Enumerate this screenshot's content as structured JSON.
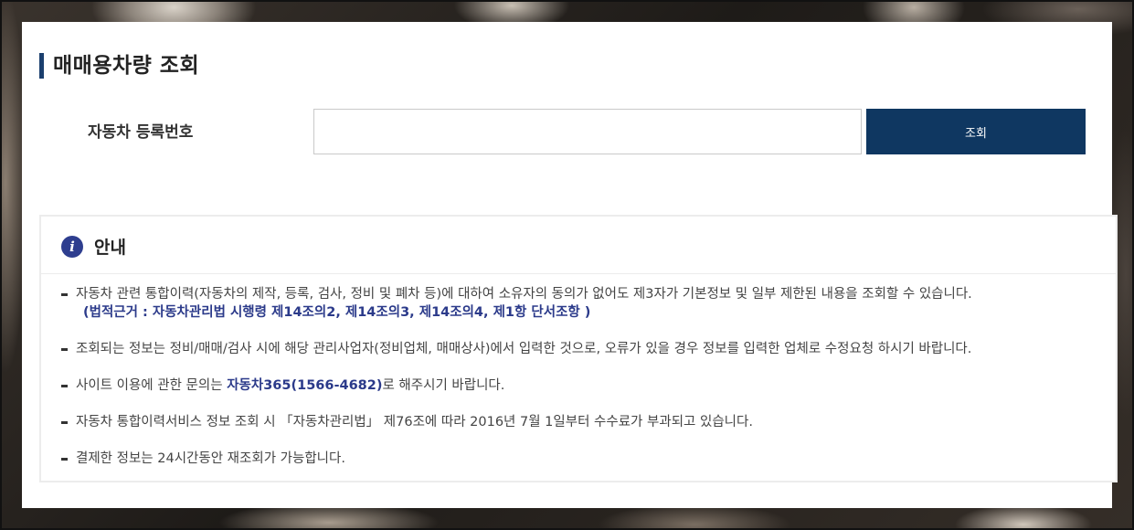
{
  "page": {
    "title": "매매용차량 조회"
  },
  "form": {
    "label": "자동차 등록번호",
    "input_value": "",
    "search_label": "조회"
  },
  "notice": {
    "title": "안내",
    "items": [
      {
        "text": "자동차 관련 통합이력(자동차의 제작, 등록, 검사, 정비 및 폐차 등)에 대하여 소유자의 동의가 없어도 제3자가 기본정보 및 일부 제한된 내용을 조회할 수 있습니다.",
        "sub": "(법적근거 : 자동차관리법 시행령 제14조의2, 제14조의3, 제14조의4, 제1항 단서조항 )"
      },
      {
        "text": "조회되는 정보는 정비/매매/검사 시에 해당 관리사업자(정비업체, 매매상사)에서 입력한 것으로, 오류가 있을 경우 정보를 입력한 업체로 수정요청 하시기 바랍니다."
      },
      {
        "pre": "사이트 이용에 관한 문의는 ",
        "highlight": "자동차365(1566-4682)",
        "post": "로 해주시기 바랍니다."
      },
      {
        "text": "자동차 통합이력서비스 정보 조회 시 「자동차관리법」 제76조에 따라 2016년 7월 1일부터 수수료가 부과되고 있습니다."
      },
      {
        "text": "결제한 정보는 24시간동안 재조회가 가능합니다."
      }
    ]
  },
  "colors": {
    "accent": "#0f3761",
    "link": "#2b3a8a",
    "icon": "#2e3e8f"
  },
  "icons": {
    "info": "info-icon"
  }
}
